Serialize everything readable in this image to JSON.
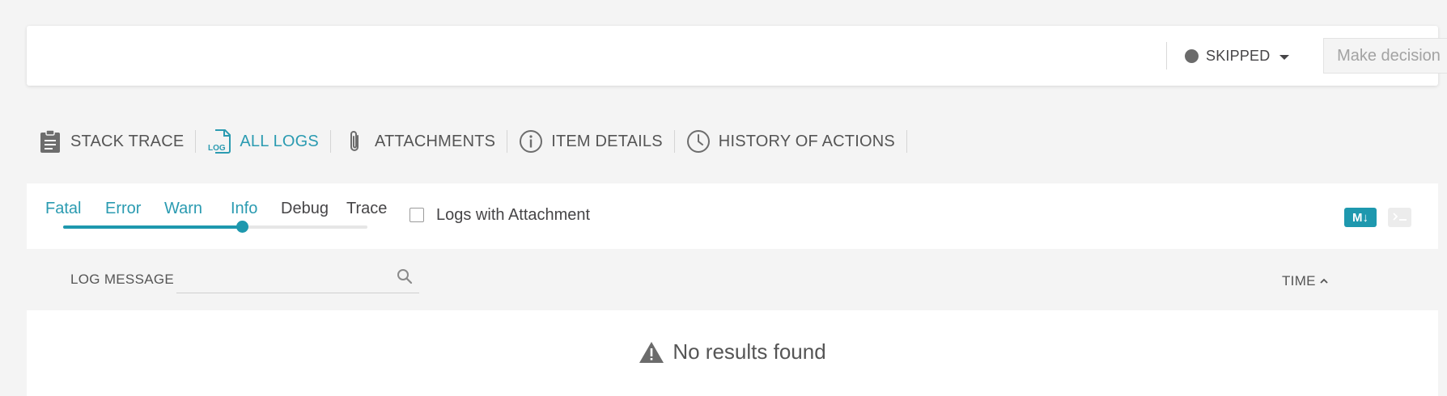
{
  "header": {
    "status_label": "SKIPPED",
    "status_color": "#6b6b6b",
    "make_decision_label": "Make decision"
  },
  "tabs": [
    {
      "label": "STACK TRACE",
      "icon": "clipboard-icon",
      "active": false
    },
    {
      "label": "ALL LOGS",
      "icon": "log-file-icon",
      "active": true
    },
    {
      "label": "ATTACHMENTS",
      "icon": "paperclip-icon",
      "active": false
    },
    {
      "label": "ITEM DETAILS",
      "icon": "info-icon",
      "active": false
    },
    {
      "label": "HISTORY OF ACTIONS",
      "icon": "clock-icon",
      "active": false
    }
  ],
  "filters": {
    "levels": [
      {
        "label": "Fatal",
        "selected": true
      },
      {
        "label": "Error",
        "selected": true
      },
      {
        "label": "Warn",
        "selected": true
      },
      {
        "label": "Info",
        "selected": true
      },
      {
        "label": "Debug",
        "selected": false
      },
      {
        "label": "Trace",
        "selected": false
      }
    ],
    "log_level_selected": "Info",
    "attachment_checkbox_label": "Logs with Attachment",
    "attachment_checked": false,
    "markdown_button_label": "M↓",
    "accent_color": "#1e98ae"
  },
  "table": {
    "log_message_header": "LOG MESSAGE",
    "search_value": "",
    "search_placeholder": "",
    "time_header": "TIME",
    "sort": "ascending"
  },
  "empty_state": {
    "message": "No results found",
    "icon": "warning-icon"
  }
}
